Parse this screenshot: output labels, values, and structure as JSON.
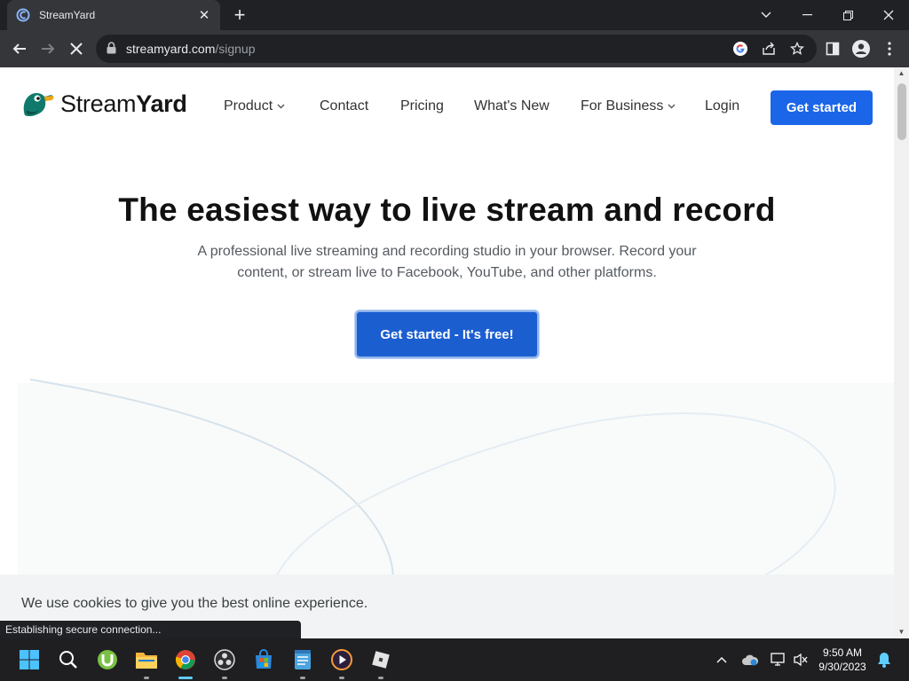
{
  "browser": {
    "tab": {
      "title": "StreamYard",
      "favicon": "streamyard-favicon"
    },
    "url_host": "streamyard.com",
    "url_path": "/signup",
    "status_text": "Establishing secure connection..."
  },
  "site": {
    "logo": {
      "word_regular": "Stream",
      "word_bold": "Yard"
    },
    "nav": [
      {
        "label": "Product",
        "dropdown": true
      },
      {
        "label": "Contact",
        "dropdown": false
      },
      {
        "label": "Pricing",
        "dropdown": false
      },
      {
        "label": "What's New",
        "dropdown": false
      },
      {
        "label": "For Business",
        "dropdown": true
      },
      {
        "label": "Login",
        "dropdown": false
      }
    ],
    "cta_top": "Get started",
    "hero": {
      "title": "The easiest way to live stream and record",
      "subtitle": "A professional live streaming and recording studio in your browser. Record your content, or stream live to Facebook, YouTube, and other platforms.",
      "cta": "Get started - It's free!"
    },
    "cookie_text": "We use cookies to give you the best online experience.",
    "colors": {
      "brand_blue": "#1b66e8",
      "hero_button": "#1b5ed0"
    }
  },
  "taskbar": {
    "apps": [
      "windows-start",
      "search",
      "utorrent",
      "file-explorer",
      "chrome",
      "obs-studio",
      "microsoft-store",
      "notepad",
      "media-player",
      "roblox"
    ],
    "time": "9:50 AM",
    "date": "9/30/2023"
  }
}
